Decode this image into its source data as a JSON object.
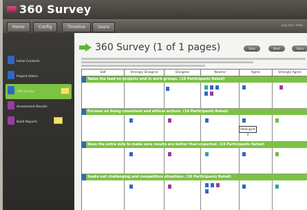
{
  "app": {
    "title": "360 Survey"
  },
  "menu": {
    "items": [
      "Home",
      "Config",
      "Timeline",
      "Users"
    ],
    "right_text": "Log out | Help"
  },
  "sidebar": {
    "items": [
      {
        "label": "Initial Contacts",
        "icon": "card-blue-icon",
        "active": false
      },
      {
        "label": "Project Admin",
        "icon": "card-blue-icon",
        "active": false
      },
      {
        "label": "360 Survey",
        "icon": "card-blue-icon",
        "active": true
      },
      {
        "label": "Assessment Results",
        "icon": "card-purple-icon",
        "active": false
      },
      {
        "label": "Build Reports",
        "icon": "card-purple-icon",
        "active": false
      }
    ]
  },
  "page": {
    "title": "360 Survey (1 of 1 pages)",
    "buttons": [
      "Save",
      "Next",
      "Done"
    ]
  },
  "columns": [
    "Self",
    "Strongly Disagree",
    "Disagree",
    "Neutral",
    "Agree",
    "Strongly Agree"
  ],
  "groups": [
    {
      "num": "1",
      "label": "Takes the lead on projects and in work groups. (18 Participants Rated)"
    },
    {
      "num": "2",
      "label": "Focuses on being consistent and ethical actions. (14 Participants Rated)"
    },
    {
      "num": "3",
      "label": "Does the extra mile to make sure results are better than expected. (16 Participants Rated)"
    },
    {
      "num": "4",
      "label": "Seeks out challenging and competitive situations. (16 Participants Rated)"
    }
  ],
  "tooltip": {
    "text": "Participant 4"
  },
  "colors": {
    "accent_green": "#7cc243",
    "blue": "#2f67c4",
    "purple": "#9c3aa6",
    "teal": "#2aa6a0"
  }
}
